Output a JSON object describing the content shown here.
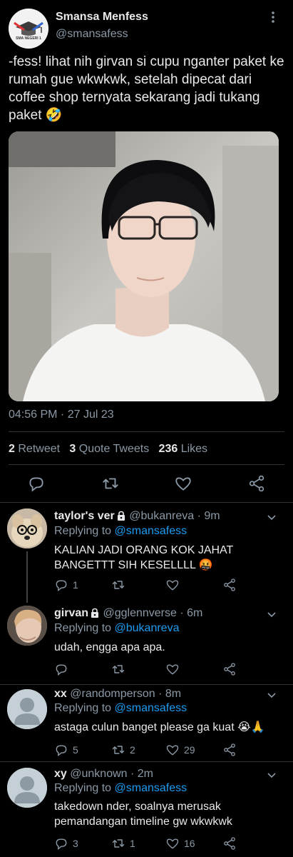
{
  "tweet": {
    "author_name": "Smansa Menfess",
    "author_handle": "@smansafess",
    "avatar_text": "SMA NEGERI 1",
    "text": "-fess! lihat nih girvan si cupu nganter paket ke rumah gue wkwkwk, setelah dipecat dari coffee shop ternyata sekarang jadi tukang paket 🤣",
    "timestamp": "04:56 PM · 27 Jul 23",
    "retweets": "2",
    "retweets_label": "Retweet",
    "quotes": "3",
    "quotes_label": "Quote Tweets",
    "likes": "236",
    "likes_label": "Likes"
  },
  "replies": [
    {
      "name": "taylor's ver",
      "handle": "@bukanreva · 9m",
      "replying_prefix": "Replying to",
      "replying_to": "@smansafess",
      "text": "KALIAN JADI ORANG KOK JAHAT BANGETTT SIH KESELLLL 🤬",
      "reply_count": "1",
      "retweet_count": "",
      "like_count": ""
    },
    {
      "name": "girvan",
      "handle": "@gglennverse · 6m",
      "replying_prefix": "Replying to",
      "replying_to": "@bukanreva",
      "text": "udah, engga apa apa.",
      "reply_count": "",
      "retweet_count": "",
      "like_count": ""
    },
    {
      "name": "xx",
      "handle": "@randomperson · 8m",
      "replying_prefix": "Replying to",
      "replying_to": "@smansafess",
      "text": "astaga culun banget please ga kuat 😭🙏",
      "reply_count": "5",
      "retweet_count": "2",
      "like_count": "29"
    },
    {
      "name": "xy",
      "handle": "@unknown · 2m",
      "replying_prefix": "Replying to",
      "replying_to": "@smansafess",
      "text": "takedown nder, soalnya merusak pemandangan timeline gw wkwkwk",
      "reply_count": "3",
      "retweet_count": "1",
      "like_count": "16"
    }
  ],
  "icons": {
    "more": "more-vertical-icon",
    "reply": "reply-icon",
    "retweet": "retweet-icon",
    "like": "heart-icon",
    "share": "share-icon",
    "lock": "lock-icon"
  },
  "colors": {
    "background": "#000000",
    "text": "#e7e9ea",
    "muted": "#8b98a5",
    "link": "#1d9bf0",
    "divider": "#2f3336"
  }
}
